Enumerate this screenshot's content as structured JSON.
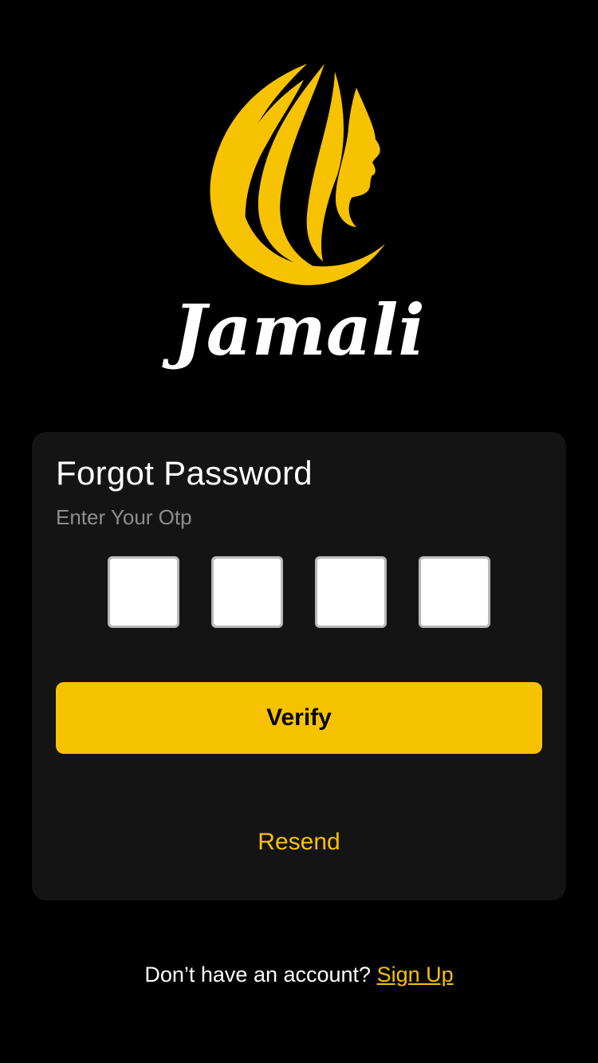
{
  "brand": {
    "logo_text": "Jamali",
    "logo_icon": "woman-hair-silhouette-icon",
    "accent_color": "#F7C200"
  },
  "card": {
    "title": "Forgot Password",
    "subtitle": "Enter Your Otp",
    "otp_digits": [
      "",
      "",
      "",
      ""
    ],
    "verify_label": "Verify",
    "resend_label": "Resend"
  },
  "footer": {
    "prompt": "Don’t have an account? ",
    "signup_label": "Sign Up"
  }
}
